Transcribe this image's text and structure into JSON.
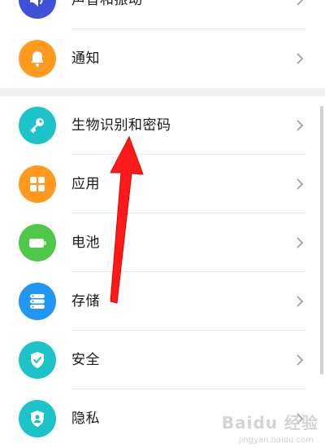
{
  "settings": {
    "items": [
      {
        "label": "声音和振动",
        "icon": "speaker-icon",
        "color": "#3f51d8"
      },
      {
        "label": "通知",
        "icon": "bell-icon",
        "color": "#ff9a1f"
      },
      {
        "label": "生物识别和密码",
        "icon": "key-icon",
        "color": "#1cc3c8"
      },
      {
        "label": "应用",
        "icon": "apps-grid-icon",
        "color": "#ff9a1f"
      },
      {
        "label": "电池",
        "icon": "battery-icon",
        "color": "#4fc84a"
      },
      {
        "label": "存储",
        "icon": "storage-icon",
        "color": "#2196f3"
      },
      {
        "label": "安全",
        "icon": "shield-check-icon",
        "color": "#1cc3c8"
      },
      {
        "label": "隐私",
        "icon": "privacy-shield-icon",
        "color": "#1cc3c8"
      }
    ]
  },
  "annotation": {
    "color": "#ff1a1a"
  },
  "watermark": {
    "text": "Baidu 经验",
    "sub": "jingyan.baidu.com"
  }
}
